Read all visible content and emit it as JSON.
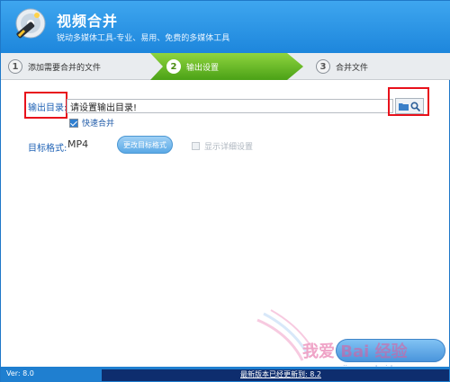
{
  "app": {
    "title": "视频合并",
    "subtitle": "锐动多媒体工具-专业、易用、免费的多媒体工具"
  },
  "steps": [
    {
      "num": "1",
      "label": "添加需要合并的文件"
    },
    {
      "num": "2",
      "label": "输出设置"
    },
    {
      "num": "3",
      "label": "合并文件"
    }
  ],
  "output": {
    "label": "输出目录:",
    "path_value": "请设置输出目录!"
  },
  "fast_merge": {
    "label": "快速合并",
    "checked": true
  },
  "format": {
    "label": "目标格式:",
    "value": "MP4",
    "change_label": "更改目标格式"
  },
  "details": {
    "label": "显示详细设置",
    "checked": false
  },
  "watermark": {
    "text": "我爱 Bai 经验",
    "url": "jingyan.baidu.com"
  },
  "status": {
    "version": "Ver: 8.0",
    "latest": "最新版本已经更新到: 8.2"
  },
  "colors": {
    "titlebar": "#2a8ad6",
    "active_step": "#5fb81f",
    "highlight": "#e8111b"
  }
}
